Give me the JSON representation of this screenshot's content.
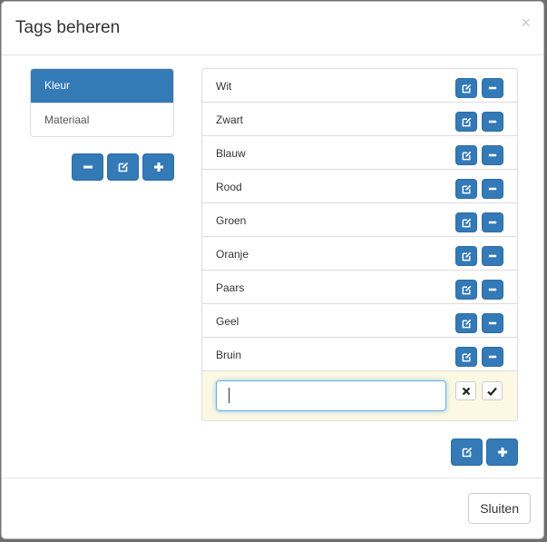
{
  "dialog": {
    "title": "Tags beheren",
    "close_symbol": "×"
  },
  "categories": [
    {
      "label": "Kleur",
      "active": true
    },
    {
      "label": "Materiaal",
      "active": false
    }
  ],
  "category_actions": {
    "remove_icon": "minus-icon",
    "edit_icon": "edit-icon",
    "add_icon": "plus-icon"
  },
  "tags": [
    {
      "label": "Wit"
    },
    {
      "label": "Zwart"
    },
    {
      "label": "Blauw"
    },
    {
      "label": "Rood"
    },
    {
      "label": "Groen"
    },
    {
      "label": "Oranje"
    },
    {
      "label": "Paars"
    },
    {
      "label": "Geel"
    },
    {
      "label": "Bruin"
    }
  ],
  "new_tag": {
    "value": "",
    "cancel_icon": "x-icon",
    "confirm_icon": "check-icon"
  },
  "footer": {
    "close_label": "Sluiten"
  },
  "colors": {
    "primary": "#337ab7",
    "warning_bg": "#fcf8e3"
  }
}
